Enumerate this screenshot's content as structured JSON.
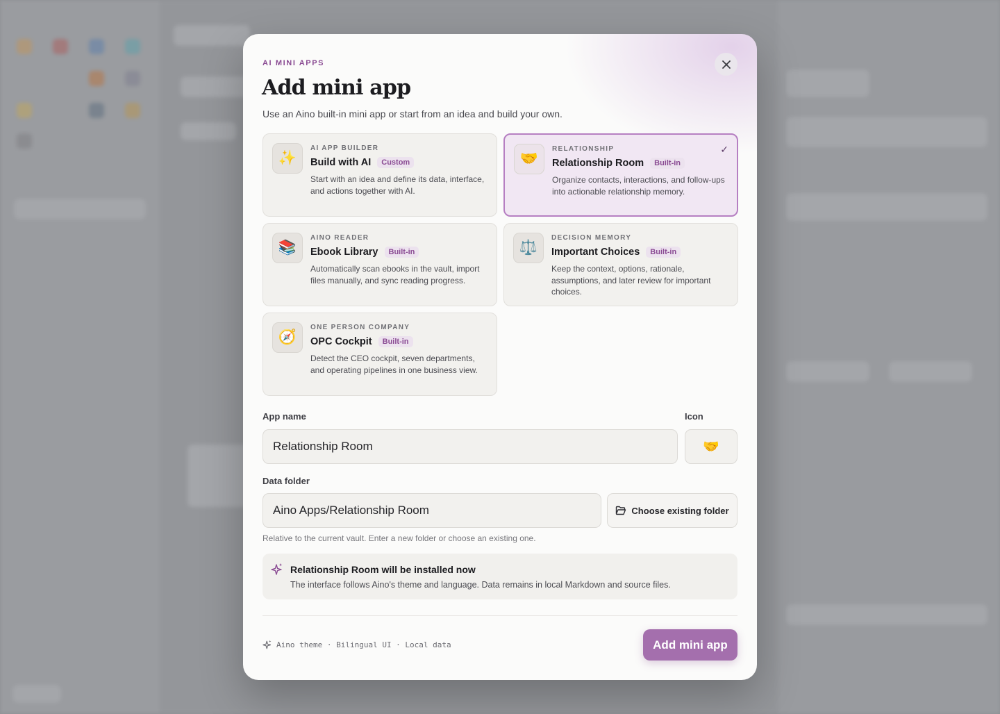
{
  "modal": {
    "eyebrow": "AI MINI APPS",
    "title": "Add mini app",
    "subtitle": "Use an Aino built-in mini app or start from an idea and build your own.",
    "close_icon": "close-icon"
  },
  "cards": [
    {
      "icon": "✨",
      "icon_name": "sparkles-icon",
      "category": "AI APP BUILDER",
      "name": "Build with AI",
      "badge": "Custom",
      "description": "Start with an idea and define its data, interface, and actions together with AI.",
      "selected": false
    },
    {
      "icon": "🤝",
      "icon_name": "handshake-icon",
      "category": "RELATIONSHIP",
      "name": "Relationship Room",
      "badge": "Built-in",
      "description": "Organize contacts, interactions, and follow-ups into actionable relationship memory.",
      "selected": true,
      "check": "✓"
    },
    {
      "icon": "📚",
      "icon_name": "books-icon",
      "category": "AINO READER",
      "name": "Ebook Library",
      "badge": "Built-in",
      "description": "Automatically scan ebooks in the vault, import files manually, and sync reading progress.",
      "selected": false
    },
    {
      "icon": "⚖️",
      "icon_name": "scales-icon",
      "category": "DECISION MEMORY",
      "name": "Important Choices",
      "badge": "Built-in",
      "description": "Keep the context, options, rationale, assumptions, and later review for important choices.",
      "selected": false
    },
    {
      "icon": "🧭",
      "icon_name": "compass-icon",
      "category": "ONE PERSON COMPANY",
      "name": "OPC Cockpit",
      "badge": "Built-in",
      "description": "Detect the CEO cockpit, seven departments, and operating pipelines in one business view.",
      "selected": false
    }
  ],
  "form": {
    "app_name_label": "App name",
    "app_name_value": "Relationship Room",
    "icon_label": "Icon",
    "icon_value": "🤝",
    "data_folder_label": "Data folder",
    "data_folder_value": "Aino Apps/Relationship Room",
    "choose_folder_label": "Choose existing folder",
    "hint": "Relative to the current vault. Enter a new folder or choose an existing one."
  },
  "notice": {
    "title": "Relationship Room will be installed now",
    "description": "The interface follows Aino's theme and language. Data remains in local Markdown and source files."
  },
  "footer": {
    "note": "Aino theme · Bilingual UI · Local data",
    "primary_label": "Add mini app"
  },
  "colors": {
    "accent": "#a46fad",
    "accent_text": "#8a4b93",
    "selected_border": "#b67fc2"
  }
}
